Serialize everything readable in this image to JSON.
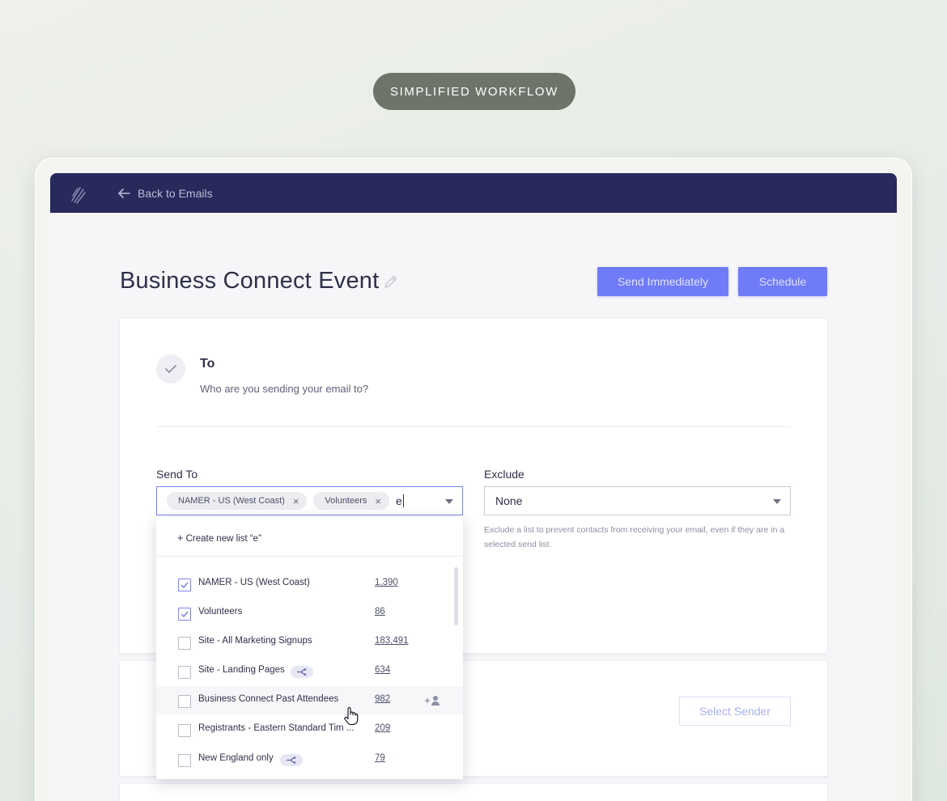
{
  "banner": {
    "label": "SIMPLIFIED WORKFLOW"
  },
  "topbar": {
    "back_label": "Back to Emails",
    "logo_icon": "brand-logo-icon",
    "back_icon": "arrow-left-icon"
  },
  "page": {
    "title": "Business Connect Event",
    "edit_icon": "pencil-icon"
  },
  "actions": {
    "send_immediately": "Send Immediately",
    "schedule": "Schedule"
  },
  "to_section": {
    "title": "To",
    "subtitle": "Who are you sending your email to?",
    "status_icon": "check-icon"
  },
  "send_to": {
    "label": "Send To",
    "chips": [
      "NAMER - US (West Coast)",
      "Volunteers"
    ],
    "chip_remove": "×",
    "typed_value": "e"
  },
  "exclude": {
    "label": "Exclude",
    "value": "None",
    "help": "Exclude a list to prevent contacts from receiving your email, even if they are in a selected send list."
  },
  "dropdown": {
    "create_new": "Create new list “e”",
    "create_plus": "+",
    "items": [
      {
        "name": "NAMER - US (West Coast)",
        "count": "1,390",
        "checked": true
      },
      {
        "name": "Volunteers",
        "count": "86",
        "checked": true
      },
      {
        "name": "Site - All Marketing Signups",
        "count": "183,491",
        "checked": false
      },
      {
        "name": "Site - Landing Pages",
        "count": "634",
        "checked": false,
        "badge": "share-icon"
      },
      {
        "name": "Business Connect Past Attendees",
        "count": "982",
        "checked": false,
        "hover_icon": "add-user-icon"
      },
      {
        "name": "Registrants - Eastern Standard Tim ...",
        "count": "209",
        "checked": false
      },
      {
        "name": "New England only",
        "count": "79",
        "checked": false,
        "badge": "share-icon"
      }
    ]
  },
  "sender": {
    "button": "Select Sender"
  },
  "colors": {
    "topbar": "#292a5c",
    "accent": "#6f7bf7",
    "pill": "#6d7469"
  }
}
